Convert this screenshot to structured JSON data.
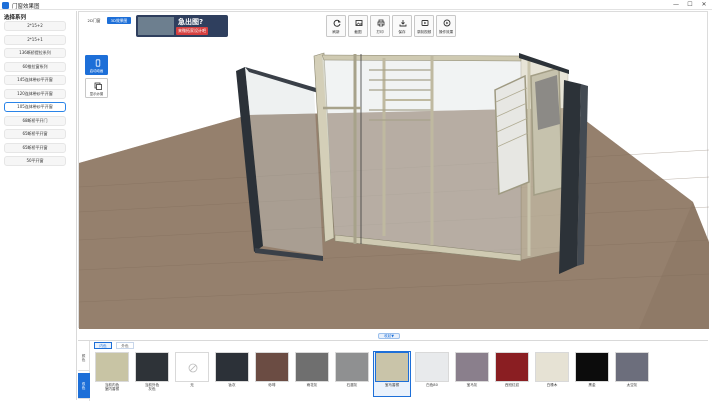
{
  "window": {
    "title": "门窗效果图",
    "min_glyph": "—",
    "max_glyph": "☐",
    "close_glyph": "✕"
  },
  "sidebar": {
    "title": "选择系列",
    "items": [
      {
        "label": "2*15+2"
      },
      {
        "label": "2*15+1"
      },
      {
        "label": "136断桥提拉系列"
      },
      {
        "label": "60推拉窗系列"
      },
      {
        "label": "145连体带纱平开窗"
      },
      {
        "label": "120连体带纱平开窗"
      },
      {
        "label": "105连体带纱平开窗",
        "active": true
      },
      {
        "label": "68断桥平开门"
      },
      {
        "label": "65断桥平开窗"
      },
      {
        "label": "65断桥平开窗"
      },
      {
        "label": "50平开窗"
      }
    ]
  },
  "view": {
    "mode_2d": "2D门窗",
    "mode_3d": "3D效果图"
  },
  "ad": {
    "headline": "急出图?",
    "sub": "来微拓家设计吧"
  },
  "toolbar": [
    {
      "label": "刷新",
      "icon": "refresh-icon"
    },
    {
      "label": "截图",
      "icon": "screenshot-icon"
    },
    {
      "label": "打印",
      "icon": "print-icon"
    },
    {
      "label": "保存",
      "icon": "save-icon"
    },
    {
      "label": "录制视频",
      "icon": "record-icon"
    },
    {
      "label": "操作效果",
      "icon": "play-icon"
    }
  ],
  "side_tools": [
    {
      "label": "启动动画",
      "icon": "phone-icon",
      "active": true
    },
    {
      "label": "显示纱窗",
      "icon": "screen-icon",
      "active": false
    }
  ],
  "collapse": {
    "label": "收起▼"
  },
  "bottom": {
    "categories": [
      {
        "label": "颜色",
        "active": false
      },
      {
        "label": "双色",
        "active": true
      }
    ],
    "sub_tabs": [
      {
        "label": "内色",
        "active": true
      },
      {
        "label": "外色",
        "active": false
      }
    ],
    "swatches": [
      {
        "label": "当前内色\n室内香槟",
        "color": "#c8c4a4"
      },
      {
        "label": "当前外色\n灰色",
        "color": "#2e3338"
      },
      {
        "label": "无",
        "color": "#ffffff"
      },
      {
        "label": "钛灰",
        "color": "#2c3138"
      },
      {
        "label": "砂啡",
        "color": "#6b4c43"
      },
      {
        "label": "雨花灰",
        "color": "#6f6f6f"
      },
      {
        "label": "石墨灰",
        "color": "#8f9091"
      },
      {
        "label": "宝马香槟",
        "color": "#c9c4a9",
        "selected": true
      },
      {
        "label": "白色80",
        "color": "#e8eaec"
      },
      {
        "label": "宝马灰",
        "color": "#8a7f8c"
      },
      {
        "label": "西班红纹",
        "color": "#8a1e22"
      },
      {
        "label": "白橡木",
        "color": "#e6e2d4"
      },
      {
        "label": "黑金",
        "color": "#0c0c0c"
      },
      {
        "label": "太空灰",
        "color": "#6c6e7c"
      }
    ]
  }
}
